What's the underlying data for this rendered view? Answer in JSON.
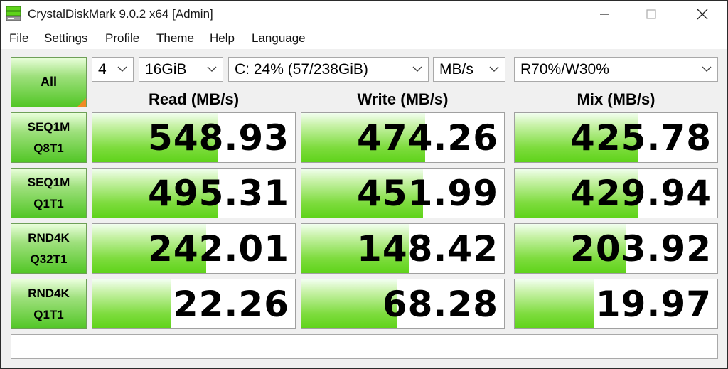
{
  "window": {
    "title": "CrystalDiskMark 9.0.2 x64 [Admin]",
    "icons": {
      "app": "disk-app-icon",
      "minimize": "minimize-icon",
      "maximize": "maximize-icon",
      "close": "close-icon"
    }
  },
  "menu": [
    "File",
    "Settings",
    "Profile",
    "Theme",
    "Help",
    "Language"
  ],
  "controls": {
    "all_label": "All",
    "count": "4",
    "size": "16GiB",
    "drive": "C: 24% (57/238GiB)",
    "unit": "MB/s",
    "mix": "R70%/W30%"
  },
  "columns": [
    "Read (MB/s)",
    "Write (MB/s)",
    "Mix (MB/s)"
  ],
  "rows": [
    {
      "label1": "SEQ1M",
      "label2": "Q8T1",
      "read": "548.93",
      "write": "474.26",
      "mix": "425.78"
    },
    {
      "label1": "SEQ1M",
      "label2": "Q1T1",
      "read": "495.31",
      "write": "451.99",
      "mix": "429.94"
    },
    {
      "label1": "RND4K",
      "label2": "Q32T1",
      "read": "242.01",
      "write": "148.42",
      "mix": "203.92"
    },
    {
      "label1": "RND4K",
      "label2": "Q1T1",
      "read": "22.26",
      "write": "68.28",
      "mix": "19.97"
    }
  ],
  "bar_fill_fraction": [
    [
      0.62,
      0.61,
      0.61
    ],
    [
      0.62,
      0.6,
      0.61
    ],
    [
      0.56,
      0.53,
      0.55
    ],
    [
      0.39,
      0.47,
      0.39
    ]
  ],
  "comment": "",
  "colors": {
    "accent_green": "#52c626",
    "corner_orange": "#f08a24"
  }
}
